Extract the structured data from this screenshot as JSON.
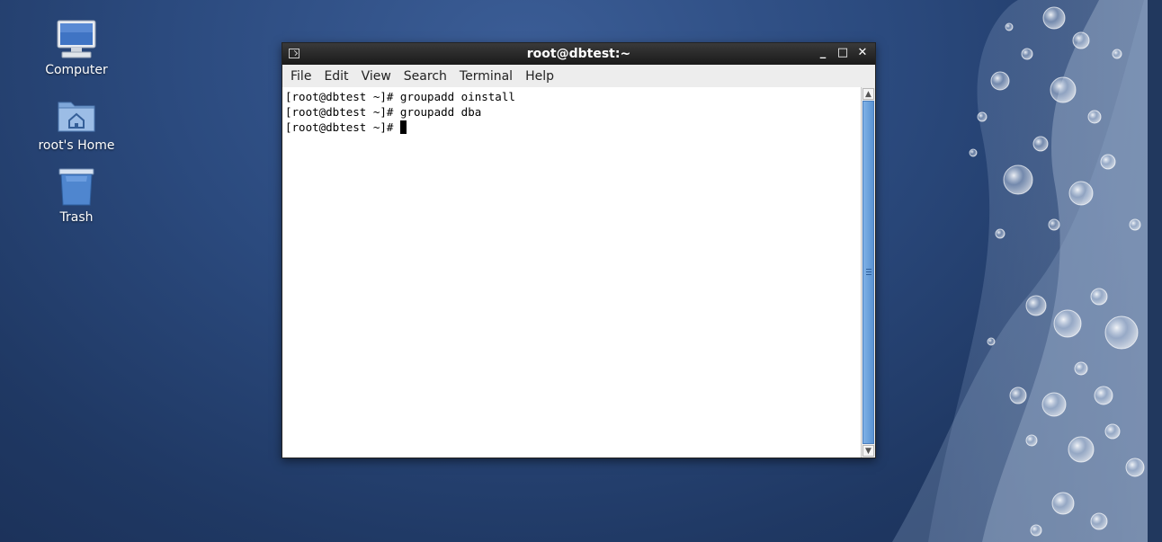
{
  "desktop": {
    "icons": [
      {
        "label": "Computer",
        "icon": "computer-icon"
      },
      {
        "label": "root's Home",
        "icon": "home-folder-icon"
      },
      {
        "label": "Trash",
        "icon": "trash-icon"
      }
    ]
  },
  "window": {
    "title": "root@dbtest:~",
    "controls": {
      "minimize": "_",
      "maximize": "□",
      "close": "✕"
    },
    "menu": [
      "File",
      "Edit",
      "View",
      "Search",
      "Terminal",
      "Help"
    ]
  },
  "terminal": {
    "lines": [
      "[root@dbtest ~]# groupadd oinstall",
      "[root@dbtest ~]# groupadd dba",
      "[root@dbtest ~]# "
    ]
  },
  "colors": {
    "desktop_bg": "#2b4a7e",
    "titlebar": "#1a1a1a",
    "scroll_thumb": "#5a93d3"
  }
}
